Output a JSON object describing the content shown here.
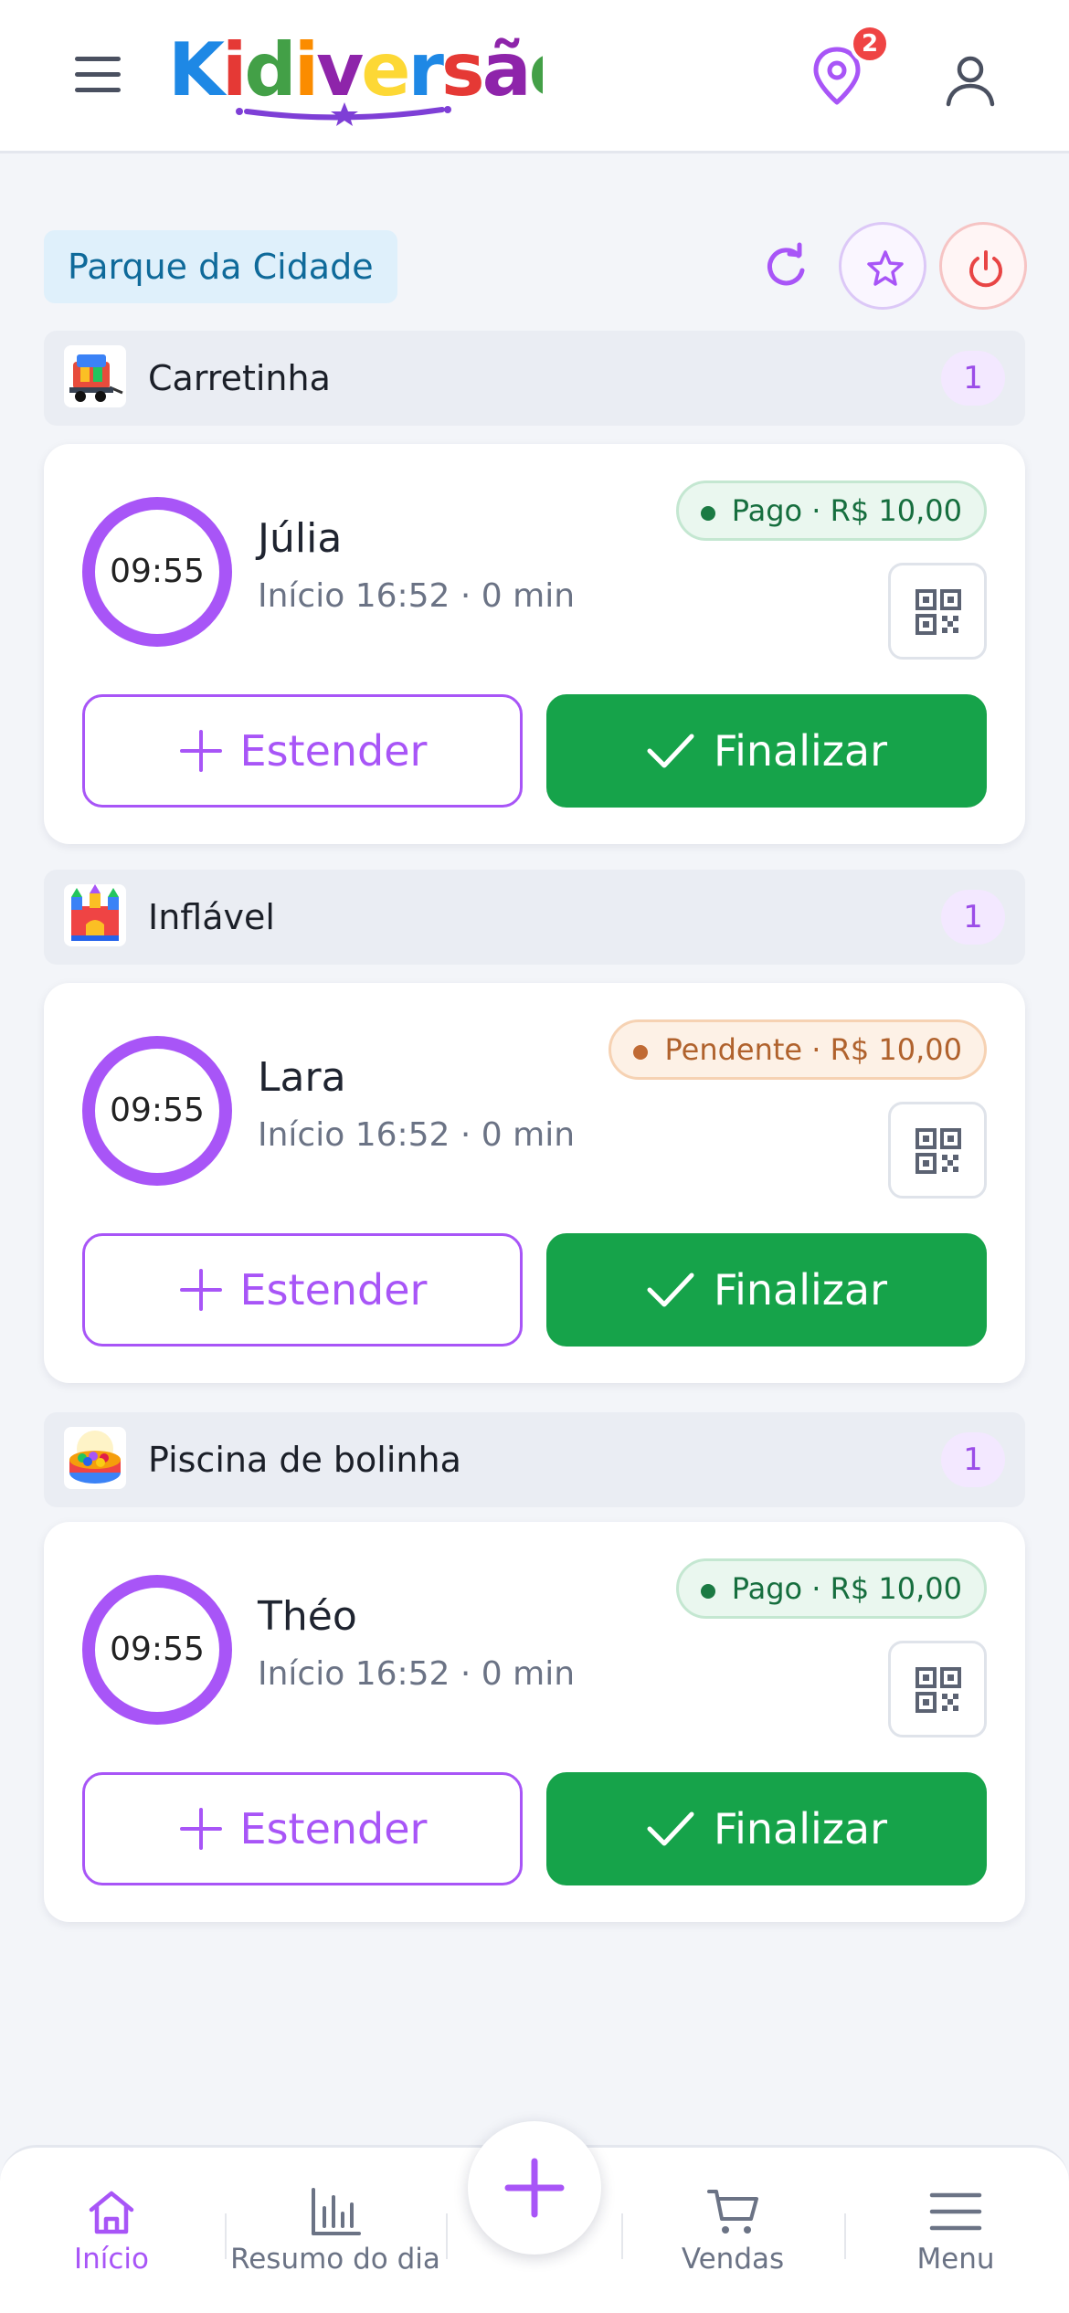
{
  "header": {
    "logo_text": "Kidiversão",
    "location_badge_count": "2",
    "colors": {
      "accent": "#a855f7",
      "badge": "#ef4444"
    }
  },
  "location": {
    "name": "Parque da Cidade"
  },
  "categories": [
    {
      "name": "Carretinha",
      "count": "1",
      "rental": {
        "timer": "09:55",
        "person": "Júlia",
        "start": "Início 16:52 · 0 min",
        "status": "Pago · R$ 10,00",
        "status_type": "paid",
        "extend_label": "Estender",
        "finish_label": "Finalizar"
      }
    },
    {
      "name": "Inflável",
      "count": "1",
      "rental": {
        "timer": "09:55",
        "person": "Lara",
        "start": "Início 16:52 · 0 min",
        "status": "Pendente · R$ 10,00",
        "status_type": "pending",
        "extend_label": "Estender",
        "finish_label": "Finalizar"
      }
    },
    {
      "name": "Piscina de bolinha",
      "count": "1",
      "rental": {
        "timer": "09:55",
        "person": "Théo",
        "start": "Início 16:52 · 0 min",
        "status": "Pago · R$ 10,00",
        "status_type": "paid",
        "extend_label": "Estender",
        "finish_label": "Finalizar"
      }
    }
  ],
  "bottom_nav": {
    "items": [
      {
        "label": "Início",
        "icon": "home-icon",
        "active": true
      },
      {
        "label": "Resumo do dia",
        "icon": "bar-chart-icon",
        "active": false
      },
      {
        "label": "Vendas",
        "icon": "cart-icon",
        "active": false
      },
      {
        "label": "Menu",
        "icon": "menu-icon",
        "active": false
      }
    ],
    "fab_icon": "plus-icon"
  }
}
